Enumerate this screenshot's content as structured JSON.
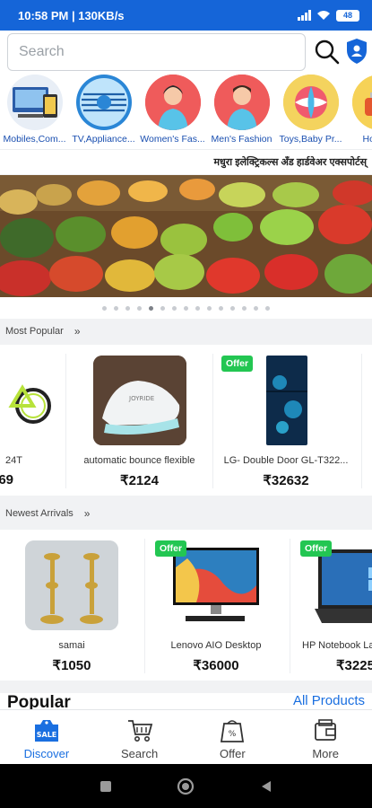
{
  "status": {
    "time": "10:58 PM | 130KB/s",
    "battery": "48"
  },
  "search": {
    "placeholder": "Search"
  },
  "categories": [
    {
      "label": "Mobiles,Com..."
    },
    {
      "label": "TV,Appliance..."
    },
    {
      "label": "Women's Fas..."
    },
    {
      "label": "Men's Fashion"
    },
    {
      "label": "Toys,Baby Pr..."
    },
    {
      "label": "Home,K"
    }
  ],
  "marquee": "मधुरा इलेक्ट्रिकल्स अँड हार्डवेअर एक्सपोर्टस्",
  "most_popular": {
    "title": "Most Popular",
    "items": [
      {
        "name": "24T",
        "price": "69"
      },
      {
        "name": "automatic bounce flexible",
        "price": "₹2124"
      },
      {
        "name": "LG- Double Door GL-T322...",
        "price": "₹32632",
        "badge": "Offer"
      }
    ]
  },
  "newest": {
    "title": "Newest Arrivals",
    "items": [
      {
        "name": "samai",
        "price": "₹1050"
      },
      {
        "name": "Lenovo AIO Desktop",
        "price": "₹36000",
        "badge": "Offer"
      },
      {
        "name": "HP Notebook La",
        "price": "₹3225",
        "badge": "Offer"
      }
    ]
  },
  "popular": {
    "title": "Popular",
    "link": "All Products"
  },
  "nav": {
    "discover": "Discover",
    "search": "Search",
    "offer": "Offer",
    "more": "More",
    "sale_badge": "SALE"
  },
  "colors": {
    "primary": "#1565d8",
    "offer": "#23c652",
    "link": "#1a6fe0"
  }
}
